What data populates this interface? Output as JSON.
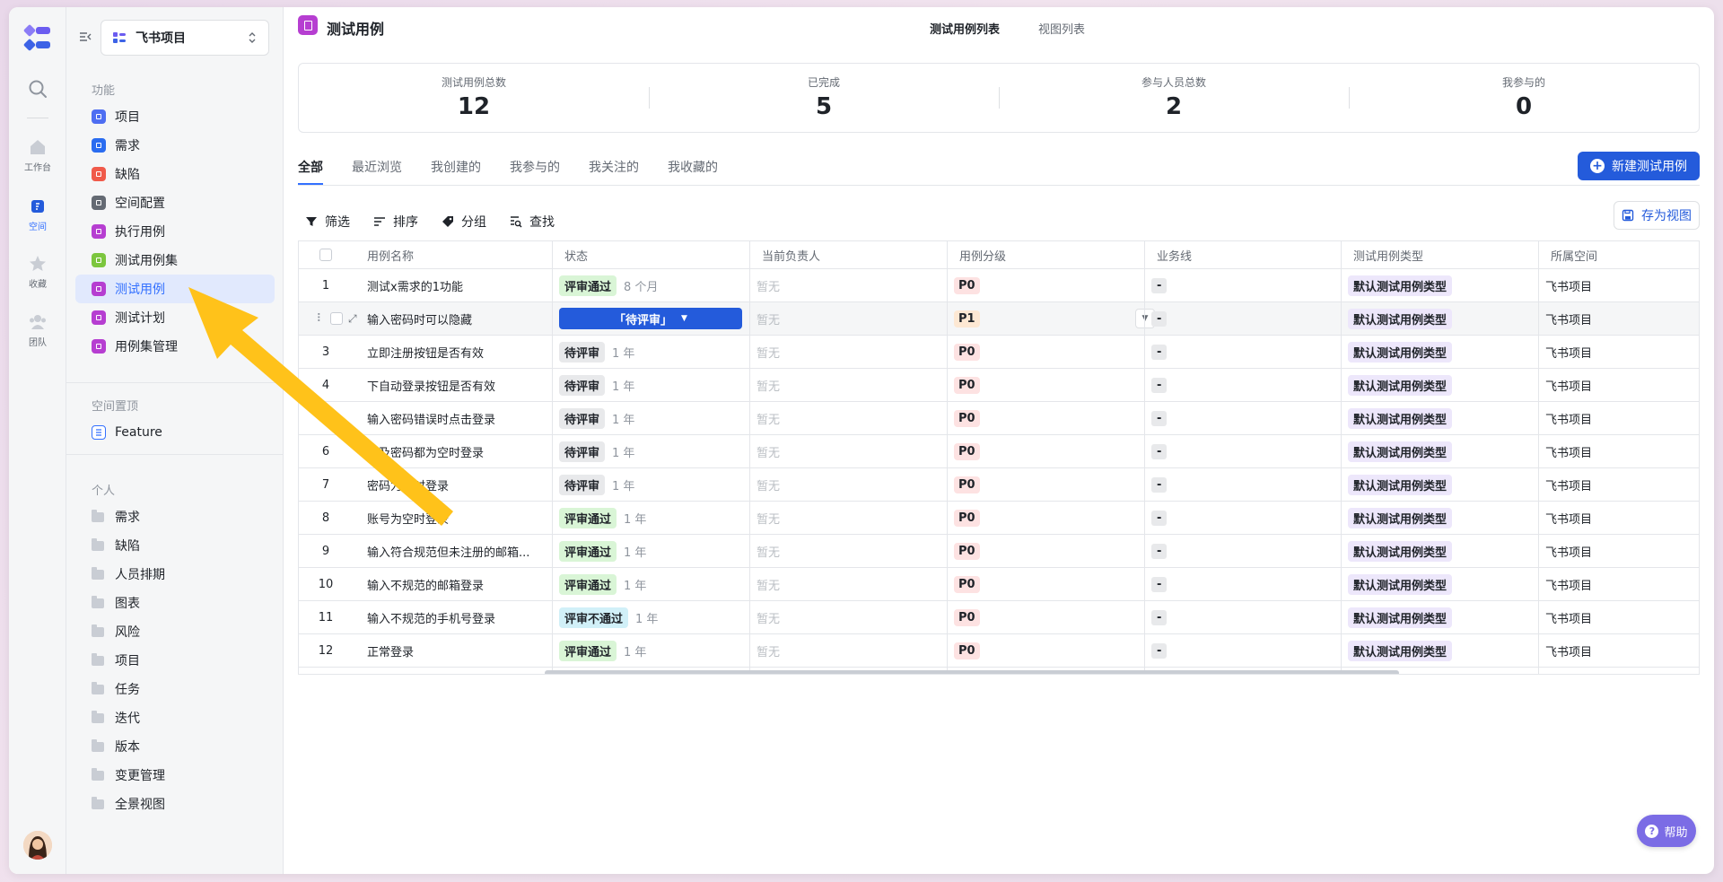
{
  "rail": {
    "items": [
      {
        "label": "工作台",
        "icon": "home-icon"
      },
      {
        "label": "空间",
        "icon": "space-icon"
      },
      {
        "label": "收藏",
        "icon": "star-icon"
      },
      {
        "label": "团队",
        "icon": "team-icon"
      }
    ]
  },
  "sidebar": {
    "project_name": "飞书项目",
    "section_features": "功能",
    "features": [
      {
        "label": "项目",
        "color": "#4e6ef2"
      },
      {
        "label": "需求",
        "color": "#2a6cf0"
      },
      {
        "label": "缺陷",
        "color": "#f05a4a"
      },
      {
        "label": "空间配置",
        "color": "#646a73"
      },
      {
        "label": "执行用例",
        "color": "#b63ed1"
      },
      {
        "label": "测试用例集",
        "color": "#7cc63e"
      },
      {
        "label": "测试用例",
        "color": "#b63ed1"
      },
      {
        "label": "测试计划",
        "color": "#b63ed1"
      },
      {
        "label": "用例集管理",
        "color": "#b63ed1"
      }
    ],
    "section_pinned": "空间置顶",
    "pinned": [
      {
        "label": "Feature"
      }
    ],
    "section_personal": "个人",
    "personal": [
      {
        "label": "需求"
      },
      {
        "label": "缺陷"
      },
      {
        "label": "人员排期"
      },
      {
        "label": "图表"
      },
      {
        "label": "风险"
      },
      {
        "label": "项目"
      },
      {
        "label": "任务"
      },
      {
        "label": "迭代"
      },
      {
        "label": "版本"
      },
      {
        "label": "变更管理"
      },
      {
        "label": "全景视图"
      }
    ]
  },
  "header": {
    "title": "测试用例",
    "view_tabs": [
      {
        "label": "测试用例列表"
      },
      {
        "label": "视图列表"
      }
    ]
  },
  "stats": [
    {
      "label": "测试用例总数",
      "value": "12"
    },
    {
      "label": "已完成",
      "value": "5"
    },
    {
      "label": "参与人员总数",
      "value": "2"
    },
    {
      "label": "我参与的",
      "value": "0"
    }
  ],
  "tabs": [
    {
      "label": "全部"
    },
    {
      "label": "最近浏览"
    },
    {
      "label": "我创建的"
    },
    {
      "label": "我参与的"
    },
    {
      "label": "我关注的"
    },
    {
      "label": "我收藏的"
    }
  ],
  "new_button": "新建测试用例",
  "toolbar": {
    "filter": "筛选",
    "sort": "排序",
    "group": "分组",
    "find": "查找",
    "save_view": "存为视图"
  },
  "table": {
    "columns": [
      "用例名称",
      "状态",
      "当前负责人",
      "用例分级",
      "业务线",
      "测试用例类型",
      "所属空间"
    ],
    "rows": [
      {
        "no": "1",
        "name": "测试x需求的1功能",
        "status": "评审通过",
        "status_kind": "pass",
        "ago": "8 个月",
        "owner": "暂无",
        "level": "P0",
        "biz": "-",
        "type": "默认测试用例类型",
        "space": "飞书项目"
      },
      {
        "no": "",
        "name": "输入密码时可以隐藏",
        "status": "「待评审」",
        "status_kind": "editing",
        "ago": "",
        "owner": "暂无",
        "level": "P1",
        "biz": "-",
        "type": "默认测试用例类型",
        "space": "飞书项目"
      },
      {
        "no": "3",
        "name": "立即注册按钮是否有效",
        "status": "待评审",
        "status_kind": "wait",
        "ago": "1 年",
        "owner": "暂无",
        "level": "P0",
        "biz": "-",
        "type": "默认测试用例类型",
        "space": "飞书项目"
      },
      {
        "no": "4",
        "name": "下自动登录按钮是否有效",
        "status": "待评审",
        "status_kind": "wait",
        "ago": "1 年",
        "owner": "暂无",
        "level": "P0",
        "biz": "-",
        "type": "默认测试用例类型",
        "space": "飞书项目"
      },
      {
        "no": "",
        "name": "输入密码错误时点击登录",
        "status": "待评审",
        "status_kind": "wait",
        "ago": "1 年",
        "owner": "暂无",
        "level": "P0",
        "biz": "-",
        "type": "默认测试用例类型",
        "space": "飞书项目"
      },
      {
        "no": "6",
        "name": "号及密码都为空时登录",
        "status": "待评审",
        "status_kind": "wait",
        "ago": "1 年",
        "owner": "暂无",
        "level": "P0",
        "biz": "-",
        "type": "默认测试用例类型",
        "space": "飞书项目"
      },
      {
        "no": "7",
        "name": "密码为空时登录",
        "status": "待评审",
        "status_kind": "wait",
        "ago": "1 年",
        "owner": "暂无",
        "level": "P0",
        "biz": "-",
        "type": "默认测试用例类型",
        "space": "飞书项目"
      },
      {
        "no": "8",
        "name": "账号为空时登录",
        "status": "评审通过",
        "status_kind": "pass",
        "ago": "1 年",
        "owner": "暂无",
        "level": "P0",
        "biz": "-",
        "type": "默认测试用例类型",
        "space": "飞书项目"
      },
      {
        "no": "9",
        "name": "输入符合规范但未注册的邮箱...",
        "status": "评审通过",
        "status_kind": "pass",
        "ago": "1 年",
        "owner": "暂无",
        "level": "P0",
        "biz": "-",
        "type": "默认测试用例类型",
        "space": "飞书项目"
      },
      {
        "no": "10",
        "name": "输入不规范的邮箱登录",
        "status": "评审通过",
        "status_kind": "pass",
        "ago": "1 年",
        "owner": "暂无",
        "level": "P0",
        "biz": "-",
        "type": "默认测试用例类型",
        "space": "飞书项目"
      },
      {
        "no": "11",
        "name": "输入不规范的手机号登录",
        "status": "评审不通过",
        "status_kind": "fail",
        "ago": "1 年",
        "owner": "暂无",
        "level": "P0",
        "biz": "-",
        "type": "默认测试用例类型",
        "space": "飞书项目"
      },
      {
        "no": "12",
        "name": "正常登录",
        "status": "评审通过",
        "status_kind": "pass",
        "ago": "1 年",
        "owner": "暂无",
        "level": "P0",
        "biz": "-",
        "type": "默认测试用例类型",
        "space": "飞书项目"
      }
    ]
  },
  "help_button": "帮助",
  "colors": {
    "accent": "#245bdb",
    "active_nav_bg": "#e1e9fd",
    "annotation_arrow": "#ffc21a"
  }
}
